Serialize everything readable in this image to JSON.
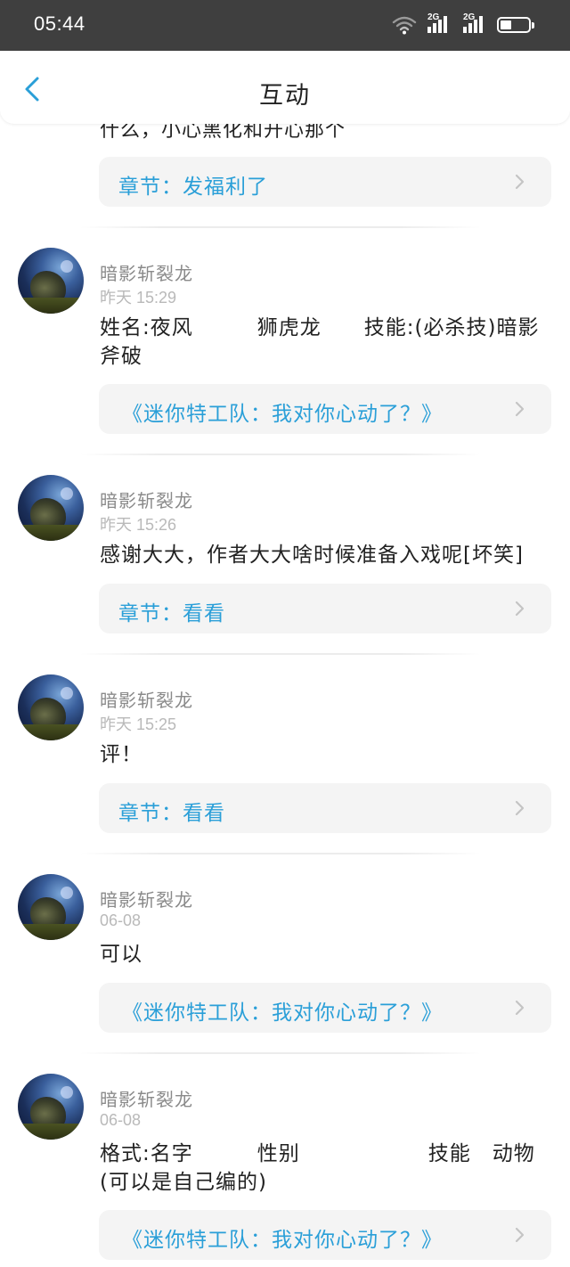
{
  "status_bar": {
    "time": "05:44",
    "signal_1_tag": "2G",
    "signal_2_tag": "2G",
    "icons": [
      "wifi-icon",
      "signal-icon",
      "signal-icon",
      "battery-icon"
    ]
  },
  "header": {
    "title": "互动",
    "back_icon": "chevron-left-icon"
  },
  "colors": {
    "link": "#2a9fd8",
    "status_bar": "#3f3f3f",
    "link_box_bg": "#f4f4f4"
  },
  "partial_top": {
    "comment_fragment": "什么，小心黑化和开心那个",
    "link": "章节：发福利了"
  },
  "items": [
    {
      "user": "暗影斩裂龙",
      "time": "昨天 15:29",
      "comment": "姓名:夜风　　　狮虎龙　　技能:(必杀技)暗影斧破",
      "link": "《迷你特工队：我对你心动了？》"
    },
    {
      "user": "暗影斩裂龙",
      "time": "昨天 15:26",
      "comment": "感谢大大，作者大大啥时候准备入戏呢[坏笑]",
      "link": "章节：看看"
    },
    {
      "user": "暗影斩裂龙",
      "time": "昨天 15:25",
      "comment": "评！",
      "link": "章节：看看"
    },
    {
      "user": "暗影斩裂龙",
      "time": "06-08",
      "comment": "可以",
      "link": "《迷你特工队：我对你心动了？》"
    },
    {
      "user": "暗影斩裂龙",
      "time": "06-08",
      "comment": "格式:名字　　　性别　　　　　　技能　动物(可以是自己编的)",
      "link": "《迷你特工队：我对你心动了？》"
    }
  ]
}
